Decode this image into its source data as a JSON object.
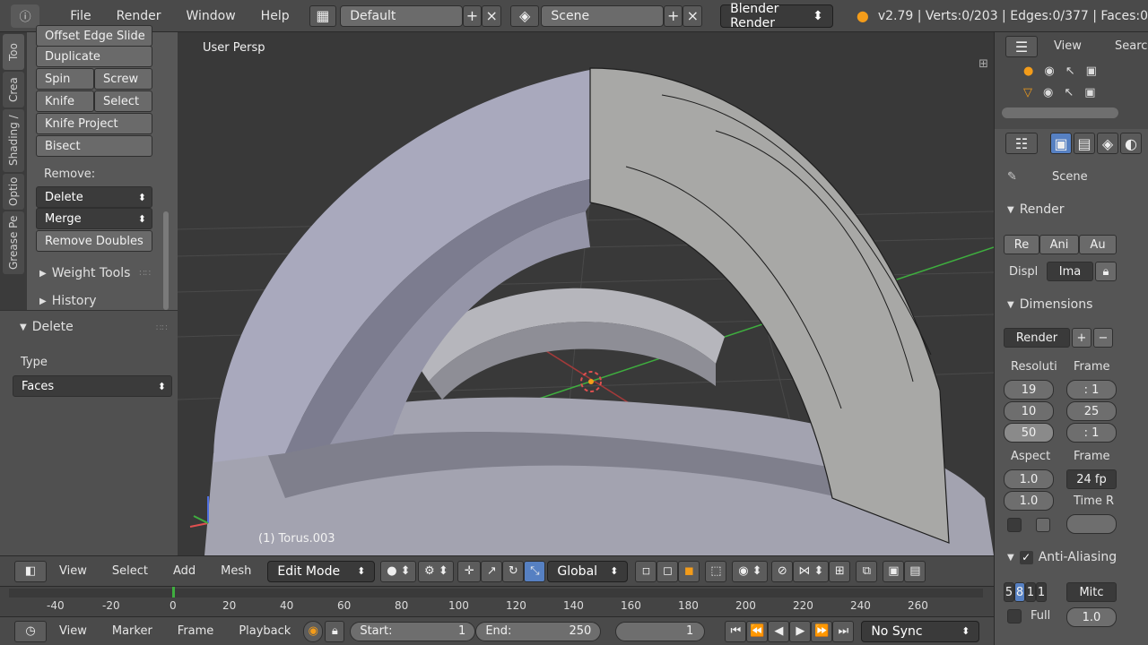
{
  "topbar": {
    "menus": [
      "File",
      "Render",
      "Window",
      "Help"
    ],
    "layout": "Default",
    "scene": "Scene",
    "engine": "Blender Render",
    "stats": "v2.79 | Verts:0/203 | Edges:0/377 | Faces:0"
  },
  "tabs": [
    "Too",
    "Crea",
    "Shading /",
    "Optio",
    "Grease Pe"
  ],
  "toolshelf": {
    "offset_edge_slide": "Offset Edge Slide",
    "duplicate": "Duplicate",
    "spin": "Spin",
    "screw": "Screw",
    "knife": "Knife",
    "select": "Select",
    "knife_project": "Knife Project",
    "bisect": "Bisect",
    "remove_label": "Remove:",
    "delete": "Delete",
    "merge": "Merge",
    "remove_doubles": "Remove Doubles",
    "weight_tools": "Weight Tools",
    "history": "History"
  },
  "operator": {
    "title": "Delete",
    "type_label": "Type",
    "type_value": "Faces"
  },
  "viewport": {
    "view_label": "User Persp",
    "object_label": "(1) Torus.003"
  },
  "outliner": {
    "view": "View",
    "search": "Search"
  },
  "props": {
    "scene": "Scene",
    "render": "Render",
    "render_btns": [
      "Re",
      "Ani",
      "Au"
    ],
    "display_label": "Displ",
    "display_value": "Ima",
    "dimensions": "Dimensions",
    "preset": "Render",
    "resolution_label": "Resoluti",
    "frame_label": "Frame",
    "res_x": "19",
    "res_y": "10",
    "res_pct": "50",
    "frame_start": ": 1",
    "frame_end": "25",
    "frame_step": ": 1",
    "aspect_label": "Aspect",
    "frame_rate_label": "Frame",
    "aspect_x": "1.0",
    "aspect_y": "1.0",
    "fps": "24 fp",
    "time_label": "Time R",
    "anti_aliasing": "Anti-Aliasing",
    "aa_samples": [
      "5",
      "8",
      "1",
      "1"
    ],
    "aa_filter": "Mitc",
    "full_label": "Full",
    "full_value": "1.0"
  },
  "vp_header": {
    "view": "View",
    "select": "Select",
    "add": "Add",
    "mesh": "Mesh",
    "mode": "Edit Mode",
    "orientation": "Global"
  },
  "timeline": {
    "ticks": [
      "-40",
      "-20",
      "0",
      "20",
      "40",
      "60",
      "80",
      "100",
      "120",
      "140",
      "160",
      "180",
      "200",
      "220",
      "240",
      "260"
    ]
  },
  "tl_header": {
    "view": "View",
    "marker": "Marker",
    "frame": "Frame",
    "playback": "Playback",
    "start_label": "Start:",
    "start_value": "1",
    "end_label": "End:",
    "end_value": "250",
    "current": "1",
    "sync": "No Sync"
  },
  "colors": {
    "accent": "#5680c2",
    "orange": "#f39c1a",
    "grid_green": "#3fae3f",
    "grid_red": "#a33a3a"
  }
}
